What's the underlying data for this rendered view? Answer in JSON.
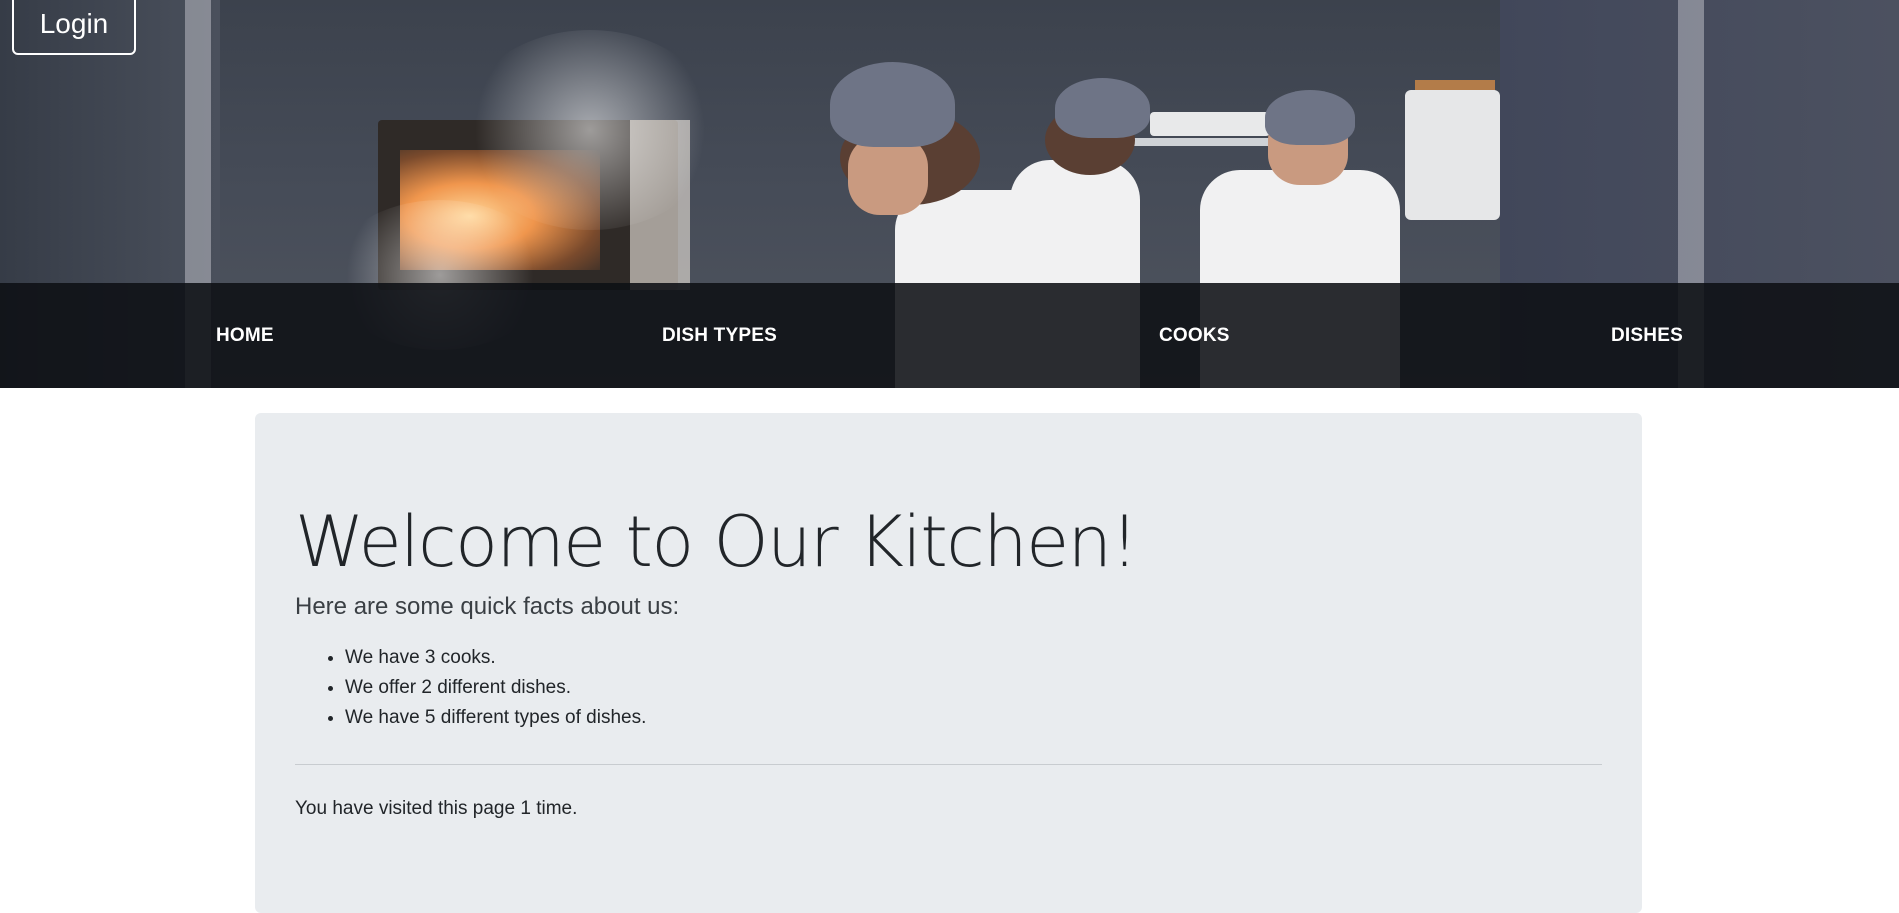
{
  "header": {
    "login_label": "Login"
  },
  "nav": {
    "items": [
      {
        "label": "HOME"
      },
      {
        "label": "DISH TYPES"
      },
      {
        "label": "COOKS"
      },
      {
        "label": "DISHES"
      }
    ]
  },
  "main": {
    "title": "Welcome to Our Kitchen!",
    "lead": "Here are some quick facts about us:",
    "facts": [
      "We have 3 cooks.",
      "We offer 2 different dishes.",
      "We have 5 different types of dishes."
    ],
    "visit_text": "You have visited this page 1 time."
  },
  "colors": {
    "navbar_bg": "#0e1014",
    "jumbotron_bg": "#e9ecef",
    "text": "#212529"
  }
}
